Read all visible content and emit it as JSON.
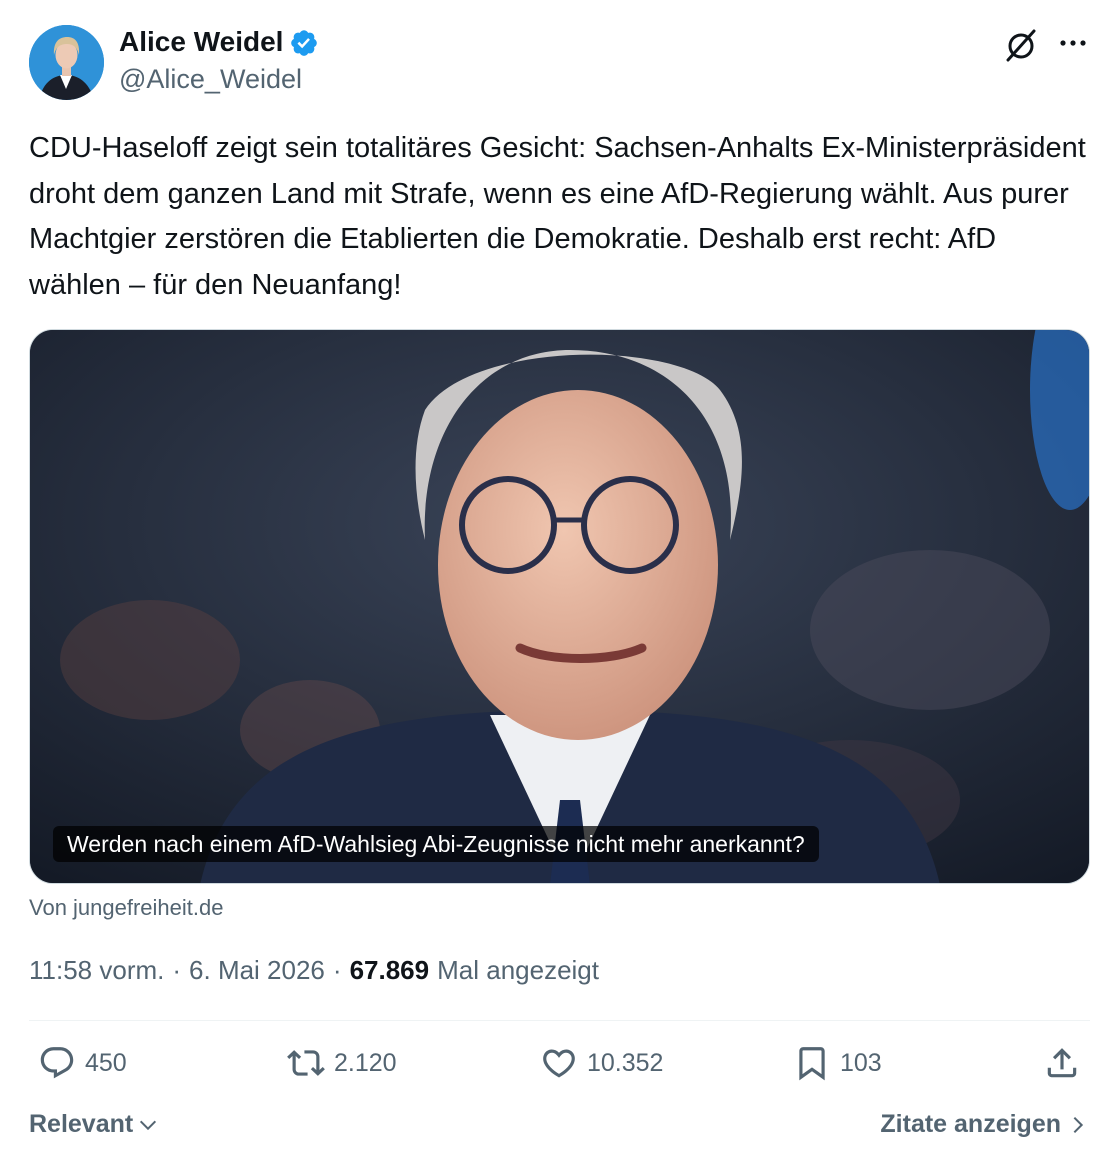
{
  "author": {
    "display_name": "Alice Weidel",
    "handle": "@Alice_Weidel",
    "verified": true,
    "avatar_icon": "avatar-portrait",
    "brand_color": "#1d9bf0"
  },
  "tweet": {
    "text": "CDU-Haseloff zeigt sein totalitäres Gesicht: Sachsen-Anhalts Ex-Ministerpräsident droht dem ganzen Land mit Strafe, wenn es eine AfD-Regierung wählt. Aus purer Machtgier zerstören die Etablierten die Demokratie. Deshalb erst recht: AfD wählen – für den Neuanfang!",
    "media_caption": "Werden nach einem AfD-Wahlsieg Abi-Zeugnisse nicht mehr anerkannt?",
    "media_source": "Von jungefreiheit.de"
  },
  "meta": {
    "time": "11:58 vorm.",
    "separator": "·",
    "date": "6. Mai 2026",
    "views_count": "67.869",
    "views_label": "Mal angezeigt"
  },
  "actions": {
    "replies": "450",
    "retweets": "2.120",
    "likes": "10.352",
    "bookmarks": "103"
  },
  "footer": {
    "sort_label": "Relevant",
    "quotes_label": "Zitate anzeigen"
  },
  "colors": {
    "text_primary": "#0f1419",
    "text_secondary": "#536471",
    "verified": "#1d9bf0"
  }
}
